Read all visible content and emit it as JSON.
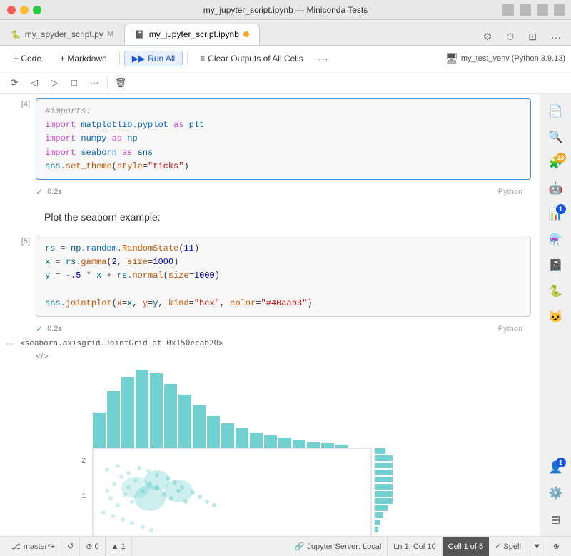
{
  "titlebar": {
    "title": "my_jupyter_script.ipynb — Miniconda Tests"
  },
  "tabs": [
    {
      "id": "spyder",
      "label": "my_spyder_script.py",
      "suffix": "M",
      "active": false
    },
    {
      "id": "jupyter",
      "label": "my_jupyter_script.ipynb",
      "dot": true,
      "active": true
    }
  ],
  "toolbar": {
    "code_label": "+ Code",
    "markdown_label": "+ Markdown",
    "run_all_label": "Run All",
    "clear_outputs_label": "Clear Outputs of All Cells",
    "env_label": "my_test_venv (Python 3.9.13)"
  },
  "cell_toolbar": {
    "buttons": [
      "restart",
      "run-before",
      "run-after",
      "run-and-advance",
      "more",
      "delete"
    ]
  },
  "cells": [
    {
      "id": 4,
      "type": "code",
      "lines": [
        "#imports:",
        "import matplotlib.pyplot as plt",
        "import numpy as np",
        "import seaborn as sns",
        "sns.set_theme(style=\"ticks\")"
      ],
      "output_time": "0.2s",
      "lang": "Python"
    },
    {
      "id": null,
      "type": "markdown",
      "text": "Plot the seaborn example:"
    },
    {
      "id": 5,
      "type": "code",
      "lines": [
        "rs = np.random.RandomState(11)",
        "x = rs.gamma(2, size=1000)",
        "y = -.5 * x + rs.normal(size=1000)",
        "",
        "sns.jointplot(x=x, y=y, kind=\"hex\", color=\"#40aab3\")"
      ],
      "output_time": "0.2s",
      "lang": "Python"
    }
  ],
  "output_text": "<seaborn.axisgrid.JointGrid at 0x150ecab20>",
  "sidebar_icons": [
    {
      "id": "files",
      "symbol": "📄",
      "badge": null
    },
    {
      "id": "search",
      "symbol": "🔍",
      "badge": null
    },
    {
      "id": "extensions",
      "symbol": "🧩",
      "badge": "13",
      "badge_color": "orange"
    },
    {
      "id": "robot",
      "symbol": "🤖",
      "badge": null
    },
    {
      "id": "table",
      "symbol": "📊",
      "badge": "1",
      "badge_color": "blue"
    },
    {
      "id": "flask",
      "symbol": "⚗️",
      "badge": null
    },
    {
      "id": "notebook",
      "symbol": "📓",
      "badge": null
    },
    {
      "id": "python",
      "symbol": "🐍",
      "badge": null
    },
    {
      "id": "github",
      "symbol": "🐱",
      "badge": null
    },
    {
      "id": "person",
      "symbol": "👤",
      "badge": "1",
      "badge_color": "blue"
    },
    {
      "id": "gear",
      "symbol": "⚙️",
      "badge": null
    },
    {
      "id": "panel",
      "symbol": "▤",
      "badge": null
    }
  ],
  "statusbar": {
    "branch": "master*+",
    "refresh": "↺",
    "errors": "⊘ 0",
    "warnings": "▲ 1",
    "server": "Jupyter Server: Local",
    "cursor": "Ln 1, Col 10",
    "cell": "Cell 1 of 5",
    "spell": "✓ Spell",
    "mode_icon": "▼",
    "zoom_icon": "⊕"
  }
}
